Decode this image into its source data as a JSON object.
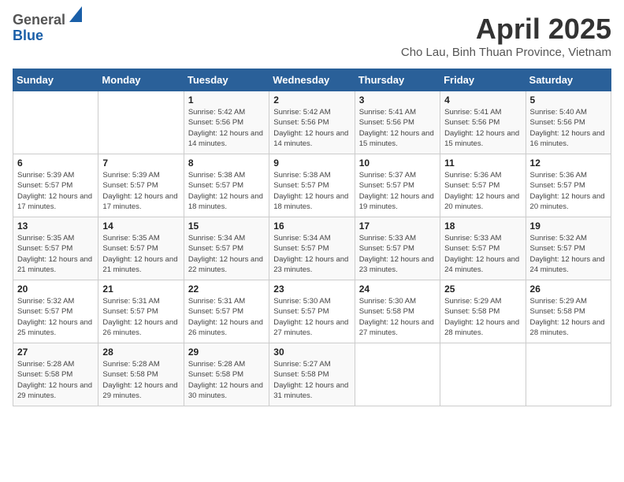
{
  "header": {
    "logo_line1": "General",
    "logo_line2": "Blue",
    "month_title": "April 2025",
    "location": "Cho Lau, Binh Thuan Province, Vietnam"
  },
  "calendar": {
    "weekdays": [
      "Sunday",
      "Monday",
      "Tuesday",
      "Wednesday",
      "Thursday",
      "Friday",
      "Saturday"
    ],
    "weeks": [
      [
        {
          "day": "",
          "info": ""
        },
        {
          "day": "",
          "info": ""
        },
        {
          "day": "1",
          "info": "Sunrise: 5:42 AM\nSunset: 5:56 PM\nDaylight: 12 hours and 14 minutes."
        },
        {
          "day": "2",
          "info": "Sunrise: 5:42 AM\nSunset: 5:56 PM\nDaylight: 12 hours and 14 minutes."
        },
        {
          "day": "3",
          "info": "Sunrise: 5:41 AM\nSunset: 5:56 PM\nDaylight: 12 hours and 15 minutes."
        },
        {
          "day": "4",
          "info": "Sunrise: 5:41 AM\nSunset: 5:56 PM\nDaylight: 12 hours and 15 minutes."
        },
        {
          "day": "5",
          "info": "Sunrise: 5:40 AM\nSunset: 5:56 PM\nDaylight: 12 hours and 16 minutes."
        }
      ],
      [
        {
          "day": "6",
          "info": "Sunrise: 5:39 AM\nSunset: 5:57 PM\nDaylight: 12 hours and 17 minutes."
        },
        {
          "day": "7",
          "info": "Sunrise: 5:39 AM\nSunset: 5:57 PM\nDaylight: 12 hours and 17 minutes."
        },
        {
          "day": "8",
          "info": "Sunrise: 5:38 AM\nSunset: 5:57 PM\nDaylight: 12 hours and 18 minutes."
        },
        {
          "day": "9",
          "info": "Sunrise: 5:38 AM\nSunset: 5:57 PM\nDaylight: 12 hours and 18 minutes."
        },
        {
          "day": "10",
          "info": "Sunrise: 5:37 AM\nSunset: 5:57 PM\nDaylight: 12 hours and 19 minutes."
        },
        {
          "day": "11",
          "info": "Sunrise: 5:36 AM\nSunset: 5:57 PM\nDaylight: 12 hours and 20 minutes."
        },
        {
          "day": "12",
          "info": "Sunrise: 5:36 AM\nSunset: 5:57 PM\nDaylight: 12 hours and 20 minutes."
        }
      ],
      [
        {
          "day": "13",
          "info": "Sunrise: 5:35 AM\nSunset: 5:57 PM\nDaylight: 12 hours and 21 minutes."
        },
        {
          "day": "14",
          "info": "Sunrise: 5:35 AM\nSunset: 5:57 PM\nDaylight: 12 hours and 21 minutes."
        },
        {
          "day": "15",
          "info": "Sunrise: 5:34 AM\nSunset: 5:57 PM\nDaylight: 12 hours and 22 minutes."
        },
        {
          "day": "16",
          "info": "Sunrise: 5:34 AM\nSunset: 5:57 PM\nDaylight: 12 hours and 23 minutes."
        },
        {
          "day": "17",
          "info": "Sunrise: 5:33 AM\nSunset: 5:57 PM\nDaylight: 12 hours and 23 minutes."
        },
        {
          "day": "18",
          "info": "Sunrise: 5:33 AM\nSunset: 5:57 PM\nDaylight: 12 hours and 24 minutes."
        },
        {
          "day": "19",
          "info": "Sunrise: 5:32 AM\nSunset: 5:57 PM\nDaylight: 12 hours and 24 minutes."
        }
      ],
      [
        {
          "day": "20",
          "info": "Sunrise: 5:32 AM\nSunset: 5:57 PM\nDaylight: 12 hours and 25 minutes."
        },
        {
          "day": "21",
          "info": "Sunrise: 5:31 AM\nSunset: 5:57 PM\nDaylight: 12 hours and 26 minutes."
        },
        {
          "day": "22",
          "info": "Sunrise: 5:31 AM\nSunset: 5:57 PM\nDaylight: 12 hours and 26 minutes."
        },
        {
          "day": "23",
          "info": "Sunrise: 5:30 AM\nSunset: 5:57 PM\nDaylight: 12 hours and 27 minutes."
        },
        {
          "day": "24",
          "info": "Sunrise: 5:30 AM\nSunset: 5:58 PM\nDaylight: 12 hours and 27 minutes."
        },
        {
          "day": "25",
          "info": "Sunrise: 5:29 AM\nSunset: 5:58 PM\nDaylight: 12 hours and 28 minutes."
        },
        {
          "day": "26",
          "info": "Sunrise: 5:29 AM\nSunset: 5:58 PM\nDaylight: 12 hours and 28 minutes."
        }
      ],
      [
        {
          "day": "27",
          "info": "Sunrise: 5:28 AM\nSunset: 5:58 PM\nDaylight: 12 hours and 29 minutes."
        },
        {
          "day": "28",
          "info": "Sunrise: 5:28 AM\nSunset: 5:58 PM\nDaylight: 12 hours and 29 minutes."
        },
        {
          "day": "29",
          "info": "Sunrise: 5:28 AM\nSunset: 5:58 PM\nDaylight: 12 hours and 30 minutes."
        },
        {
          "day": "30",
          "info": "Sunrise: 5:27 AM\nSunset: 5:58 PM\nDaylight: 12 hours and 31 minutes."
        },
        {
          "day": "",
          "info": ""
        },
        {
          "day": "",
          "info": ""
        },
        {
          "day": "",
          "info": ""
        }
      ]
    ]
  }
}
